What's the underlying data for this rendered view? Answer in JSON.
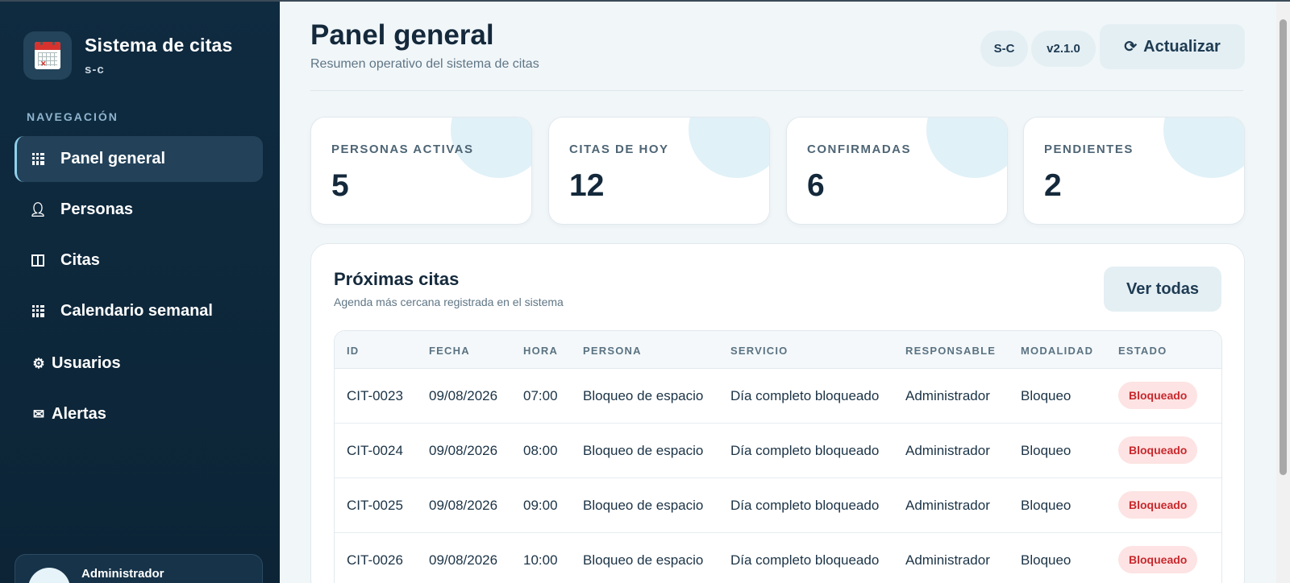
{
  "app": {
    "title": "Sistema de citas",
    "subtitle": "s-c"
  },
  "sidebar": {
    "heading": "NAVEGACIÓN",
    "items": [
      {
        "label": "Panel general",
        "icon": "grid-icon",
        "active": true
      },
      {
        "label": "Personas",
        "icon": "person-icon"
      },
      {
        "label": "Citas",
        "icon": "book-icon"
      },
      {
        "label": "Calendario semanal",
        "icon": "calendar-grid-icon"
      },
      {
        "label": "Usuarios",
        "icon": "gear-icon"
      },
      {
        "label": "Alertas",
        "icon": "mail-icon"
      }
    ],
    "user": {
      "name": "Administrador"
    }
  },
  "header": {
    "title": "Panel general",
    "subtitle": "Resumen operativo del sistema de citas",
    "badge_sc": "S-C",
    "badge_version": "v2.1.0",
    "refresh_label": "Actualizar"
  },
  "stats": [
    {
      "label": "PERSONAS ACTIVAS",
      "value": "5"
    },
    {
      "label": "CITAS DE HOY",
      "value": "12"
    },
    {
      "label": "CONFIRMADAS",
      "value": "6"
    },
    {
      "label": "PENDIENTES",
      "value": "2"
    }
  ],
  "appointments": {
    "title": "Próximas citas",
    "subtitle": "Agenda más cercana registrada en el sistema",
    "view_all_label": "Ver todas",
    "columns": [
      "ID",
      "FECHA",
      "HORA",
      "PERSONA",
      "SERVICIO",
      "RESPONSABLE",
      "MODALIDAD",
      "ESTADO"
    ],
    "rows": [
      {
        "id": "CIT-0023",
        "fecha": "09/08/2026",
        "hora": "07:00",
        "persona": "Bloqueo de espacio",
        "servicio": "Día completo bloqueado",
        "responsable": "Administrador",
        "modalidad": "Bloqueo",
        "estado": "Bloqueado"
      },
      {
        "id": "CIT-0024",
        "fecha": "09/08/2026",
        "hora": "08:00",
        "persona": "Bloqueo de espacio",
        "servicio": "Día completo bloqueado",
        "responsable": "Administrador",
        "modalidad": "Bloqueo",
        "estado": "Bloqueado"
      },
      {
        "id": "CIT-0025",
        "fecha": "09/08/2026",
        "hora": "09:00",
        "persona": "Bloqueo de espacio",
        "servicio": "Día completo bloqueado",
        "responsable": "Administrador",
        "modalidad": "Bloqueo",
        "estado": "Bloqueado"
      },
      {
        "id": "CIT-0026",
        "fecha": "09/08/2026",
        "hora": "10:00",
        "persona": "Bloqueo de espacio",
        "servicio": "Día completo bloqueado",
        "responsable": "Administrador",
        "modalidad": "Bloqueo",
        "estado": "Bloqueado"
      }
    ]
  },
  "colors": {
    "sidebar_bg": "#0f2b40",
    "accent": "#8fd1ee",
    "status_blocked": "#c8282d"
  }
}
